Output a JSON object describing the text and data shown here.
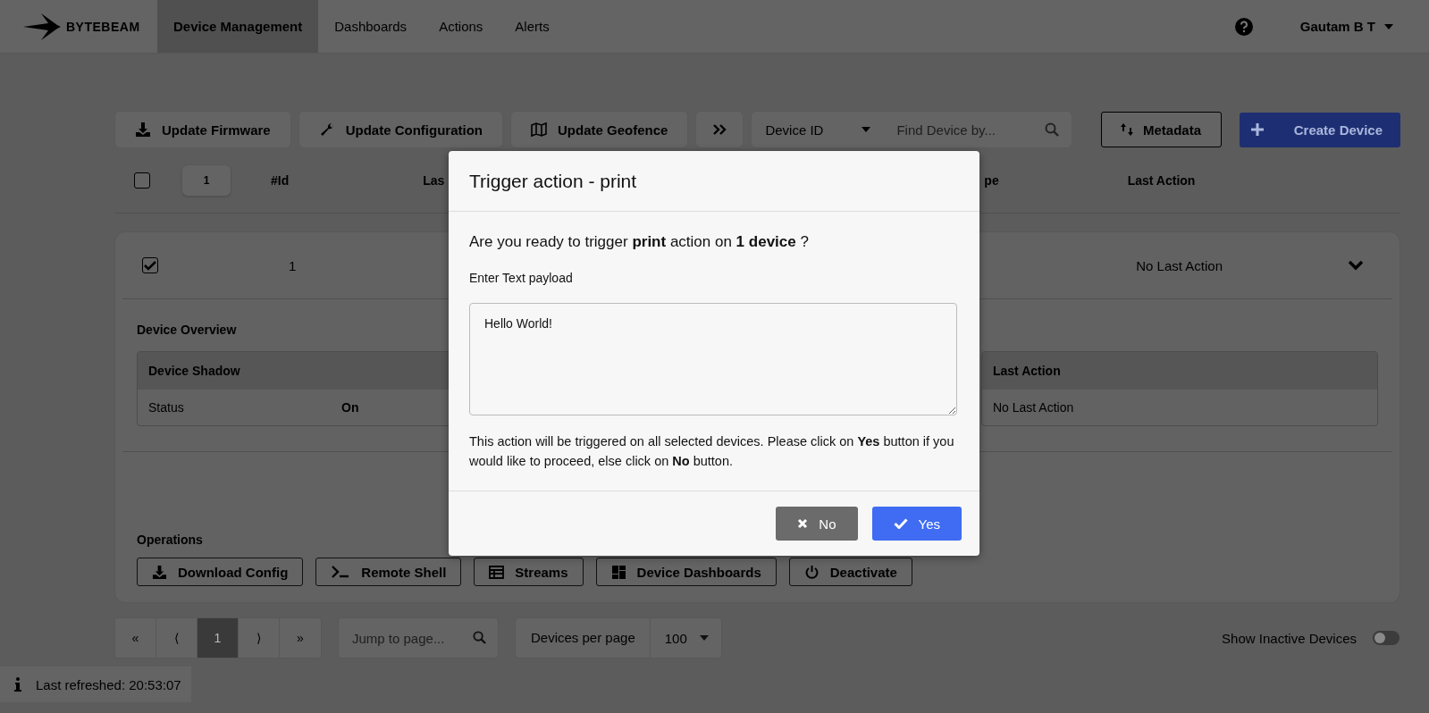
{
  "nav": {
    "logo": "BYTEBEAM",
    "tabs": [
      {
        "label": "Device Management",
        "selected": true
      },
      {
        "label": "Dashboards",
        "selected": false
      },
      {
        "label": "Actions",
        "selected": false
      },
      {
        "label": "Alerts",
        "selected": false
      }
    ],
    "user": "Gautam B T"
  },
  "toolbar": {
    "buttons": [
      {
        "label": "Update Firmware",
        "kind": "download"
      },
      {
        "label": "Update Configuration",
        "kind": "wrench"
      },
      {
        "label": "Update Geofence",
        "kind": "map"
      }
    ],
    "filter": "Device ID",
    "search_placeholder": "Find Device by...",
    "metadata": "Metadata",
    "create": "Create Device"
  },
  "table": {
    "select_all_checked": false,
    "selected_count": "1",
    "columns": [
      "#Id",
      "Las",
      "pe",
      "Last Action"
    ],
    "row": {
      "checked": true,
      "id": "1",
      "last_action": "No Last Action",
      "expanded": true
    }
  },
  "overview": {
    "title": "Device Overview",
    "shadow_header": "Device Shadow",
    "shadow_rows": [
      {
        "label": "Status",
        "value": "On"
      }
    ],
    "last_action_header": "Last Action",
    "last_action_value": "No Last Action"
  },
  "operations": {
    "title": "Operations",
    "buttons": [
      {
        "label": "Download Config",
        "kind": "download"
      },
      {
        "label": "Remote Shell",
        "kind": "shell"
      },
      {
        "label": "Streams",
        "kind": "grid"
      },
      {
        "label": "Device Dashboards",
        "kind": "dash"
      },
      {
        "label": "Deactivate",
        "kind": "power"
      }
    ]
  },
  "pagination": {
    "pages": [
      {
        "label": "«",
        "selected": false
      },
      {
        "label": "⟨",
        "selected": false
      },
      {
        "label": "1",
        "selected": true
      },
      {
        "label": "⟩",
        "selected": false
      },
      {
        "label": "»",
        "selected": false
      }
    ],
    "jump_placeholder": "Jump to page...",
    "per_page_label": "Devices per page",
    "per_page": "100"
  },
  "show_inactive": {
    "label": "Show Inactive Devices",
    "on": false
  },
  "toast": "Last refreshed: 20:53:07",
  "modal": {
    "title": "Trigger action - print",
    "question": "Are you ready to trigger **print** action on **1 device** ?",
    "field_label": "Enter Text payload",
    "payload": "Hello World!",
    "note": "This action will be triggered on all selected devices. Please click on **Yes** button if you would like to proceed, else click on **No** button.",
    "buttons": [
      {
        "label": "No",
        "kind": "cancel"
      },
      {
        "label": "Yes",
        "kind": "confirm"
      }
    ]
  }
}
